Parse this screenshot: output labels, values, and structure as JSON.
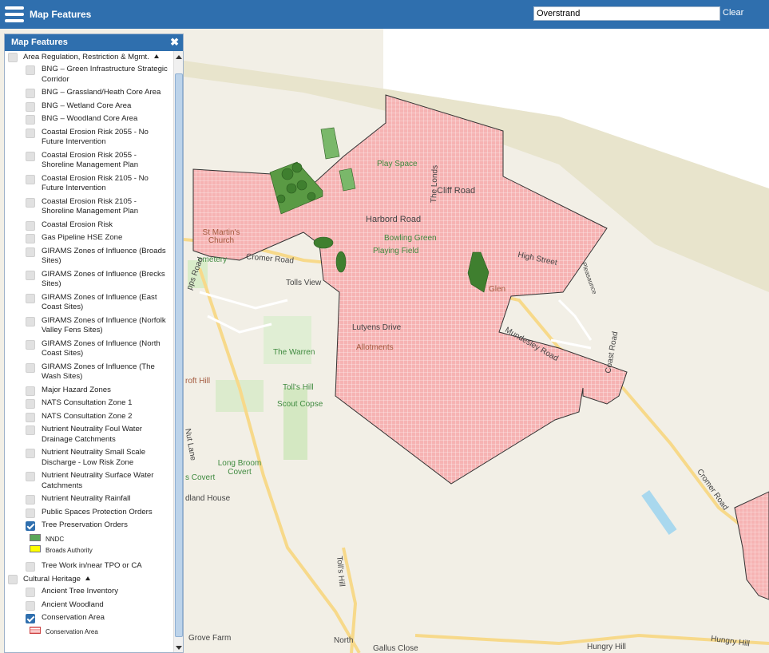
{
  "app": {
    "title": "Map Features"
  },
  "search": {
    "value": "Overstrand",
    "clear_label": "Clear"
  },
  "panel": {
    "title": "Map Features",
    "close_icon": "close-icon",
    "groups": [
      {
        "label": "Area Regulation, Restriction & Mgmt.",
        "layers": [
          {
            "label": "BNG – Green Infrastructure Strategic Corridor",
            "checked": false
          },
          {
            "label": "BNG – Grassland/Heath Core Area",
            "checked": false
          },
          {
            "label": "BNG – Wetland Core Area",
            "checked": false
          },
          {
            "label": "BNG – Woodland Core Area",
            "checked": false
          },
          {
            "label": "Coastal Erosion Risk 2055 - No Future Intervention",
            "checked": false
          },
          {
            "label": "Coastal Erosion Risk 2055 - Shoreline Management Plan",
            "checked": false
          },
          {
            "label": "Coastal Erosion Risk 2105 - No Future Intervention",
            "checked": false
          },
          {
            "label": "Coastal Erosion Risk 2105 - Shoreline Management Plan",
            "checked": false
          },
          {
            "label": "Coastal Erosion Risk",
            "checked": false
          },
          {
            "label": "Gas Pipeline HSE Zone",
            "checked": false
          },
          {
            "label": "GIRAMS Zones of Influence (Broads Sites)",
            "checked": false
          },
          {
            "label": "GIRAMS Zones of Influence (Brecks Sites)",
            "checked": false
          },
          {
            "label": "GIRAMS Zones of Influence (East Coast Sites)",
            "checked": false
          },
          {
            "label": "GIRAMS Zones of Influence (Norfolk Valley Fens Sites)",
            "checked": false
          },
          {
            "label": "GIRAMS Zones of Influence (North Coast Sites)",
            "checked": false
          },
          {
            "label": "GIRAMS Zones of Influence (The Wash Sites)",
            "checked": false
          },
          {
            "label": "Major Hazard Zones",
            "checked": false
          },
          {
            "label": "NATS Consultation Zone 1",
            "checked": false
          },
          {
            "label": "NATS Consultation Zone 2",
            "checked": false
          },
          {
            "label": "Nutrient Neutrality Foul Water Drainage Catchments",
            "checked": false
          },
          {
            "label": "Nutrient Neutrality Small Scale Discharge - Low Risk Zone",
            "checked": false
          },
          {
            "label": "Nutrient Neutrality Surface Water Catchments",
            "checked": false
          },
          {
            "label": "Nutrient Neutrality Rainfall",
            "checked": false
          },
          {
            "label": "Public Spaces Protection Orders",
            "checked": false
          },
          {
            "label": "Tree Preservation Orders",
            "checked": true,
            "legend": [
              {
                "label": "NNDC",
                "color": "#5aa85a",
                "pattern": "solid"
              },
              {
                "label": "Broads Authority",
                "color": "#ffff00",
                "pattern": "solid"
              }
            ]
          },
          {
            "label": "Tree Work in/near TPO or CA",
            "checked": false
          }
        ]
      },
      {
        "label": "Cultural Heritage",
        "layers": [
          {
            "label": "Ancient Tree Inventory",
            "checked": false
          },
          {
            "label": "Ancient Woodland",
            "checked": false
          },
          {
            "label": "Conservation Area",
            "checked": true,
            "legend": [
              {
                "label": "Conservation Area",
                "color": "#f4a6a6",
                "pattern": "grid"
              }
            ]
          }
        ]
      }
    ]
  },
  "map": {
    "colors": {
      "land": "#f2efe6",
      "beach": "#e6e1c8",
      "conservation": "#f4a6a6",
      "tpo": "#3f7f2f",
      "road": "#f7d98a"
    },
    "labels": [
      {
        "text": "Play Space",
        "kind": "green"
      },
      {
        "text": "Cliff Road",
        "kind": "road"
      },
      {
        "text": "The Londs",
        "kind": "road"
      },
      {
        "text": "Harbord Road",
        "kind": "road"
      },
      {
        "text": "St Martin's Church",
        "kind": "brown"
      },
      {
        "text": "Bowling Green",
        "kind": "green"
      },
      {
        "text": "Playing Field",
        "kind": "green"
      },
      {
        "text": "Cromer Road",
        "kind": "road"
      },
      {
        "text": "High Street",
        "kind": "road"
      },
      {
        "text": "Pleasaunce",
        "kind": "road"
      },
      {
        "text": "Tolls View",
        "kind": "road"
      },
      {
        "text": "emetery",
        "kind": "green"
      },
      {
        "text": "Lutyens Drive",
        "kind": "road"
      },
      {
        "text": "The Warren",
        "kind": "green"
      },
      {
        "text": "Allotments",
        "kind": "brown"
      },
      {
        "text": "Mundesley Road",
        "kind": "road"
      },
      {
        "text": "Coast Road",
        "kind": "road"
      },
      {
        "text": "Toll's Hill",
        "kind": "green"
      },
      {
        "text": "Scout Copse",
        "kind": "green"
      },
      {
        "text": "roft Hill",
        "kind": "brown"
      },
      {
        "text": "Nut Lane",
        "kind": "road"
      },
      {
        "text": "Long Broom Covert",
        "kind": "green"
      },
      {
        "text": "s Covert",
        "kind": "green"
      },
      {
        "text": "dland House",
        "kind": "road"
      },
      {
        "text": "Cromer Road",
        "kind": "road"
      },
      {
        "text": "Toll's Hill",
        "kind": "road"
      },
      {
        "text": "Grove Farm",
        "kind": "road"
      },
      {
        "text": "North",
        "kind": "road"
      },
      {
        "text": "Gallus Close",
        "kind": "road"
      },
      {
        "text": "Hungry Hill",
        "kind": "road"
      },
      {
        "text": "Hungry Hill",
        "kind": "road"
      },
      {
        "text": "Glen",
        "kind": "brown"
      },
      {
        "text": "pps Road",
        "kind": "road"
      }
    ]
  }
}
